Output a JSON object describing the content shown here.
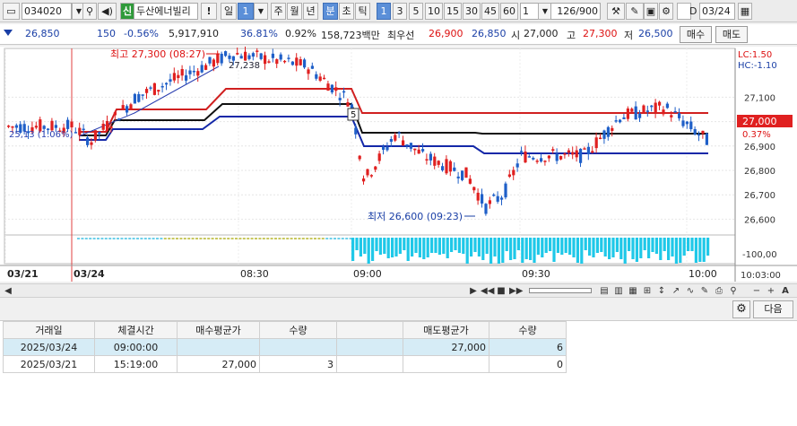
{
  "toolbar": {
    "code": "034020",
    "credit_badge": "신",
    "stock_name": "두산에너빌리",
    "alert": "!",
    "period_day": "일",
    "period_num": "1",
    "periods": [
      "주",
      "월",
      "년",
      "분",
      "초",
      "틱"
    ],
    "selected_period": "분",
    "intervals": [
      "1",
      "3",
      "5",
      "10",
      "15",
      "30",
      "45",
      "60"
    ],
    "selected_interval": "1",
    "count_select": "1",
    "bar_count": "126/900",
    "date_label": "D",
    "date_value": "03/24"
  },
  "info": {
    "price": "26,850",
    "change": "150",
    "change_pct": "-0.56%",
    "volume": "5,917,910",
    "vol_ratio": "36.81%",
    "turnover": "0.92%",
    "trade_value": "158,723백만",
    "best_quote_label": "최우선",
    "best_ask": "26,900",
    "best_bid": "26,850",
    "open_label": "시",
    "open": "27,000",
    "high_label": "고",
    "high": "27,300",
    "low_label": "저",
    "low": "26,500",
    "buy_label": "매수",
    "sell_label": "매도"
  },
  "chart_labels": {
    "high_annot": "최고 27,300 (08:27)",
    "low_annot": "최저 26,600 (09:23)",
    "left_annot": "25,13 (1.06%)",
    "peak_annot": "27,238",
    "marker": "5",
    "lc": "LC:1.50",
    "hc": "HC:-1.10",
    "current_price": "27,000",
    "current_pct": "0.37%",
    "sub_tick": "-100,00",
    "time_right": "10:03:00"
  },
  "chart_data": {
    "type": "candlestick",
    "y_ticks": [
      "27,100",
      "27,000",
      "26,900",
      "26,800",
      "26,700",
      "26,600"
    ],
    "ylim": [
      26550,
      27300
    ],
    "x_ticks": [
      "03/21",
      "03/24",
      "08:30",
      "09:00",
      "09:30",
      "10:00"
    ],
    "high": 27300,
    "low": 26600,
    "current": 27000
  },
  "scrollbar": {
    "nav": [
      "◀",
      "▶",
      "◀◀",
      "■",
      "▶▶"
    ],
    "tools_right": [
      "−",
      "+",
      "A"
    ]
  },
  "grid": {
    "settings_icon": "gear-icon",
    "next_label": "다음",
    "headers": [
      "거래일",
      "체결시간",
      "매수평균가",
      "수량",
      "",
      "매도평균가",
      "수량"
    ],
    "rows": [
      [
        "2025/03/24",
        "09:00:00",
        "",
        "",
        "",
        "27,000",
        "6"
      ],
      [
        "2025/03/21",
        "15:19:00",
        "27,000",
        "3",
        "",
        "",
        "0"
      ]
    ]
  },
  "colors": {
    "up": "#e02020",
    "down": "#1f5fc8",
    "sub_bar": "#1fc8e8",
    "accent": "#5b8fd8"
  }
}
